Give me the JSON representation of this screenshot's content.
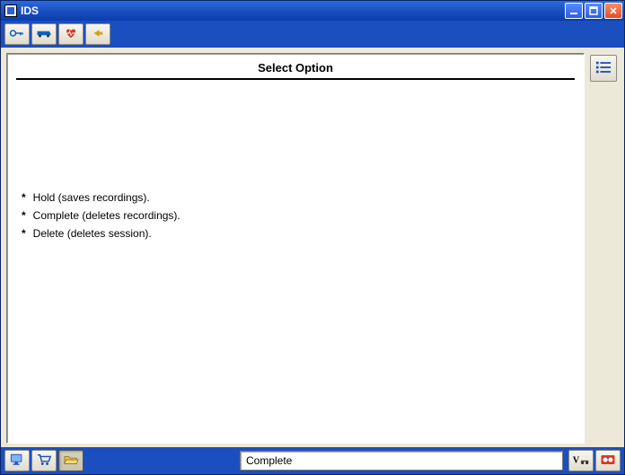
{
  "titlebar": {
    "app_title": "IDS"
  },
  "main": {
    "heading": "Select Option",
    "options": [
      "Hold (saves recordings).",
      "Complete (deletes recordings).",
      "Delete (deletes session)."
    ]
  },
  "statusbar": {
    "status_text": "Complete"
  },
  "icons": {
    "key": "key-icon",
    "truck": "truck-icon",
    "heart": "heart-icon",
    "back": "back-arrow-icon",
    "list": "list-icon",
    "monitor": "monitor-icon",
    "cart": "cart-icon",
    "folder": "folder-open-icon",
    "vinfo": "vehicle-info-icon",
    "rec": "record-icon"
  }
}
